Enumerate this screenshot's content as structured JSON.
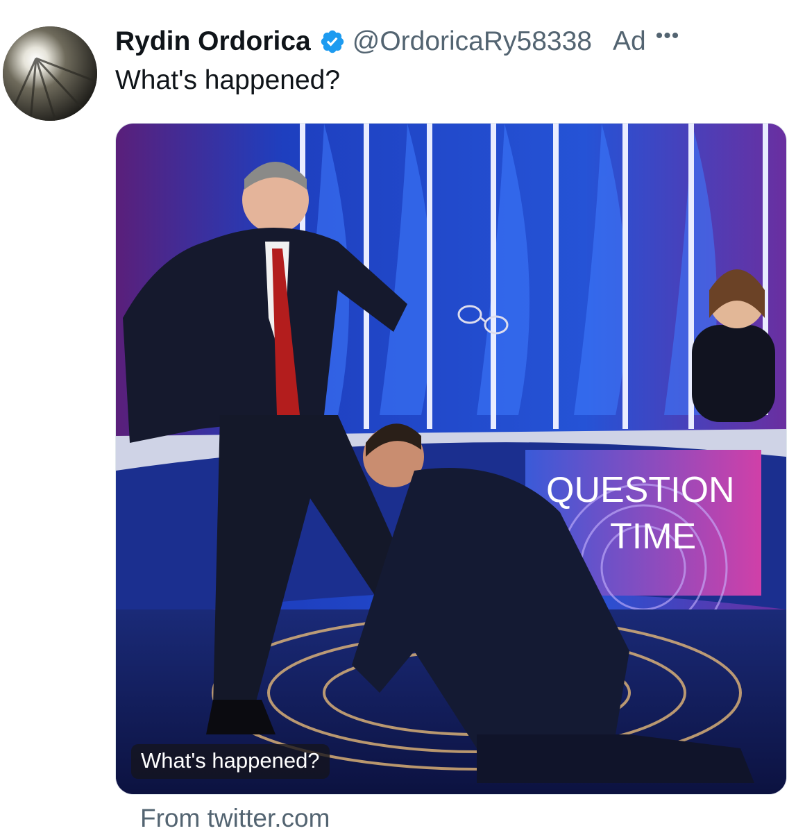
{
  "post": {
    "display_name": "Rydin Ordorica",
    "handle": "@OrdoricaRy58338",
    "ad_label": "Ad",
    "more_label": "•••",
    "verified_icon": "verified-badge-icon",
    "text": "What's happened?"
  },
  "media": {
    "caption": "What's happened?",
    "screen_text_line1": "QUESTION",
    "screen_text_line2": "TIME"
  },
  "card_source": "From twitter.com",
  "colors": {
    "text_primary": "#0f1419",
    "text_secondary": "#536471",
    "verified": "#1d9bf0"
  }
}
